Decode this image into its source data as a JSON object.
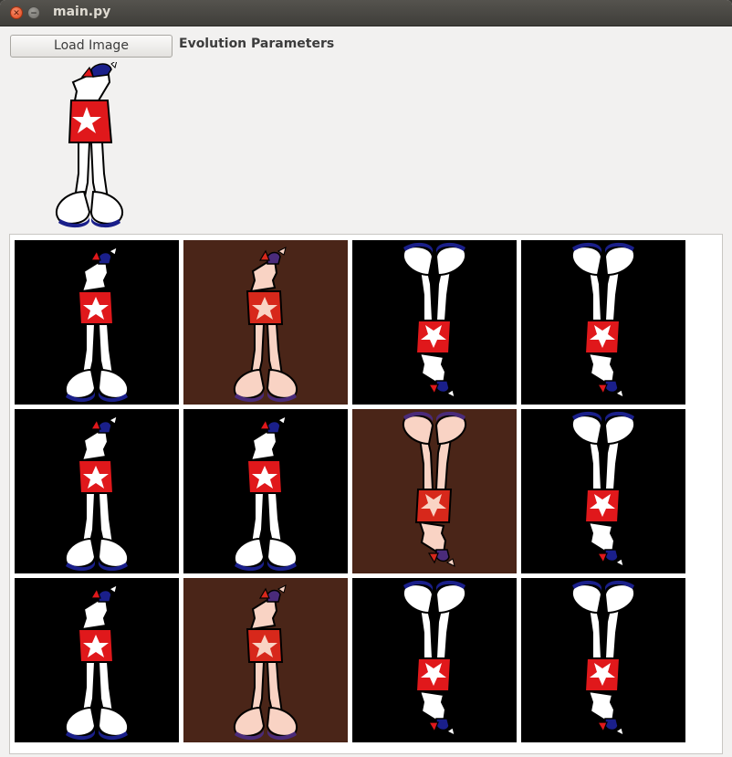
{
  "window": {
    "title": "main.py"
  },
  "toolbar": {
    "load_image_label": "Load Image",
    "params_label": "Evolution Parameters"
  },
  "colors": {
    "black_bg": "#000000",
    "brown_bg": "#4a2518",
    "red": "#e0181b",
    "pink": "#f9d3c4",
    "navy": "#1a1f8a",
    "white": "#ffffff"
  },
  "grid": {
    "rows": 3,
    "cols": 4,
    "cells": [
      {
        "bg": "black",
        "flipped": false,
        "tint": "normal"
      },
      {
        "bg": "brown",
        "flipped": false,
        "tint": "pink"
      },
      {
        "bg": "black",
        "flipped": true,
        "tint": "normal"
      },
      {
        "bg": "black",
        "flipped": true,
        "tint": "normal"
      },
      {
        "bg": "black",
        "flipped": false,
        "tint": "normal"
      },
      {
        "bg": "black",
        "flipped": false,
        "tint": "normal"
      },
      {
        "bg": "brown",
        "flipped": true,
        "tint": "pink"
      },
      {
        "bg": "black",
        "flipped": true,
        "tint": "normal"
      },
      {
        "bg": "black",
        "flipped": false,
        "tint": "normal"
      },
      {
        "bg": "brown",
        "flipped": false,
        "tint": "pink"
      },
      {
        "bg": "black",
        "flipped": true,
        "tint": "normal"
      },
      {
        "bg": "black",
        "flipped": true,
        "tint": "normal"
      }
    ]
  }
}
